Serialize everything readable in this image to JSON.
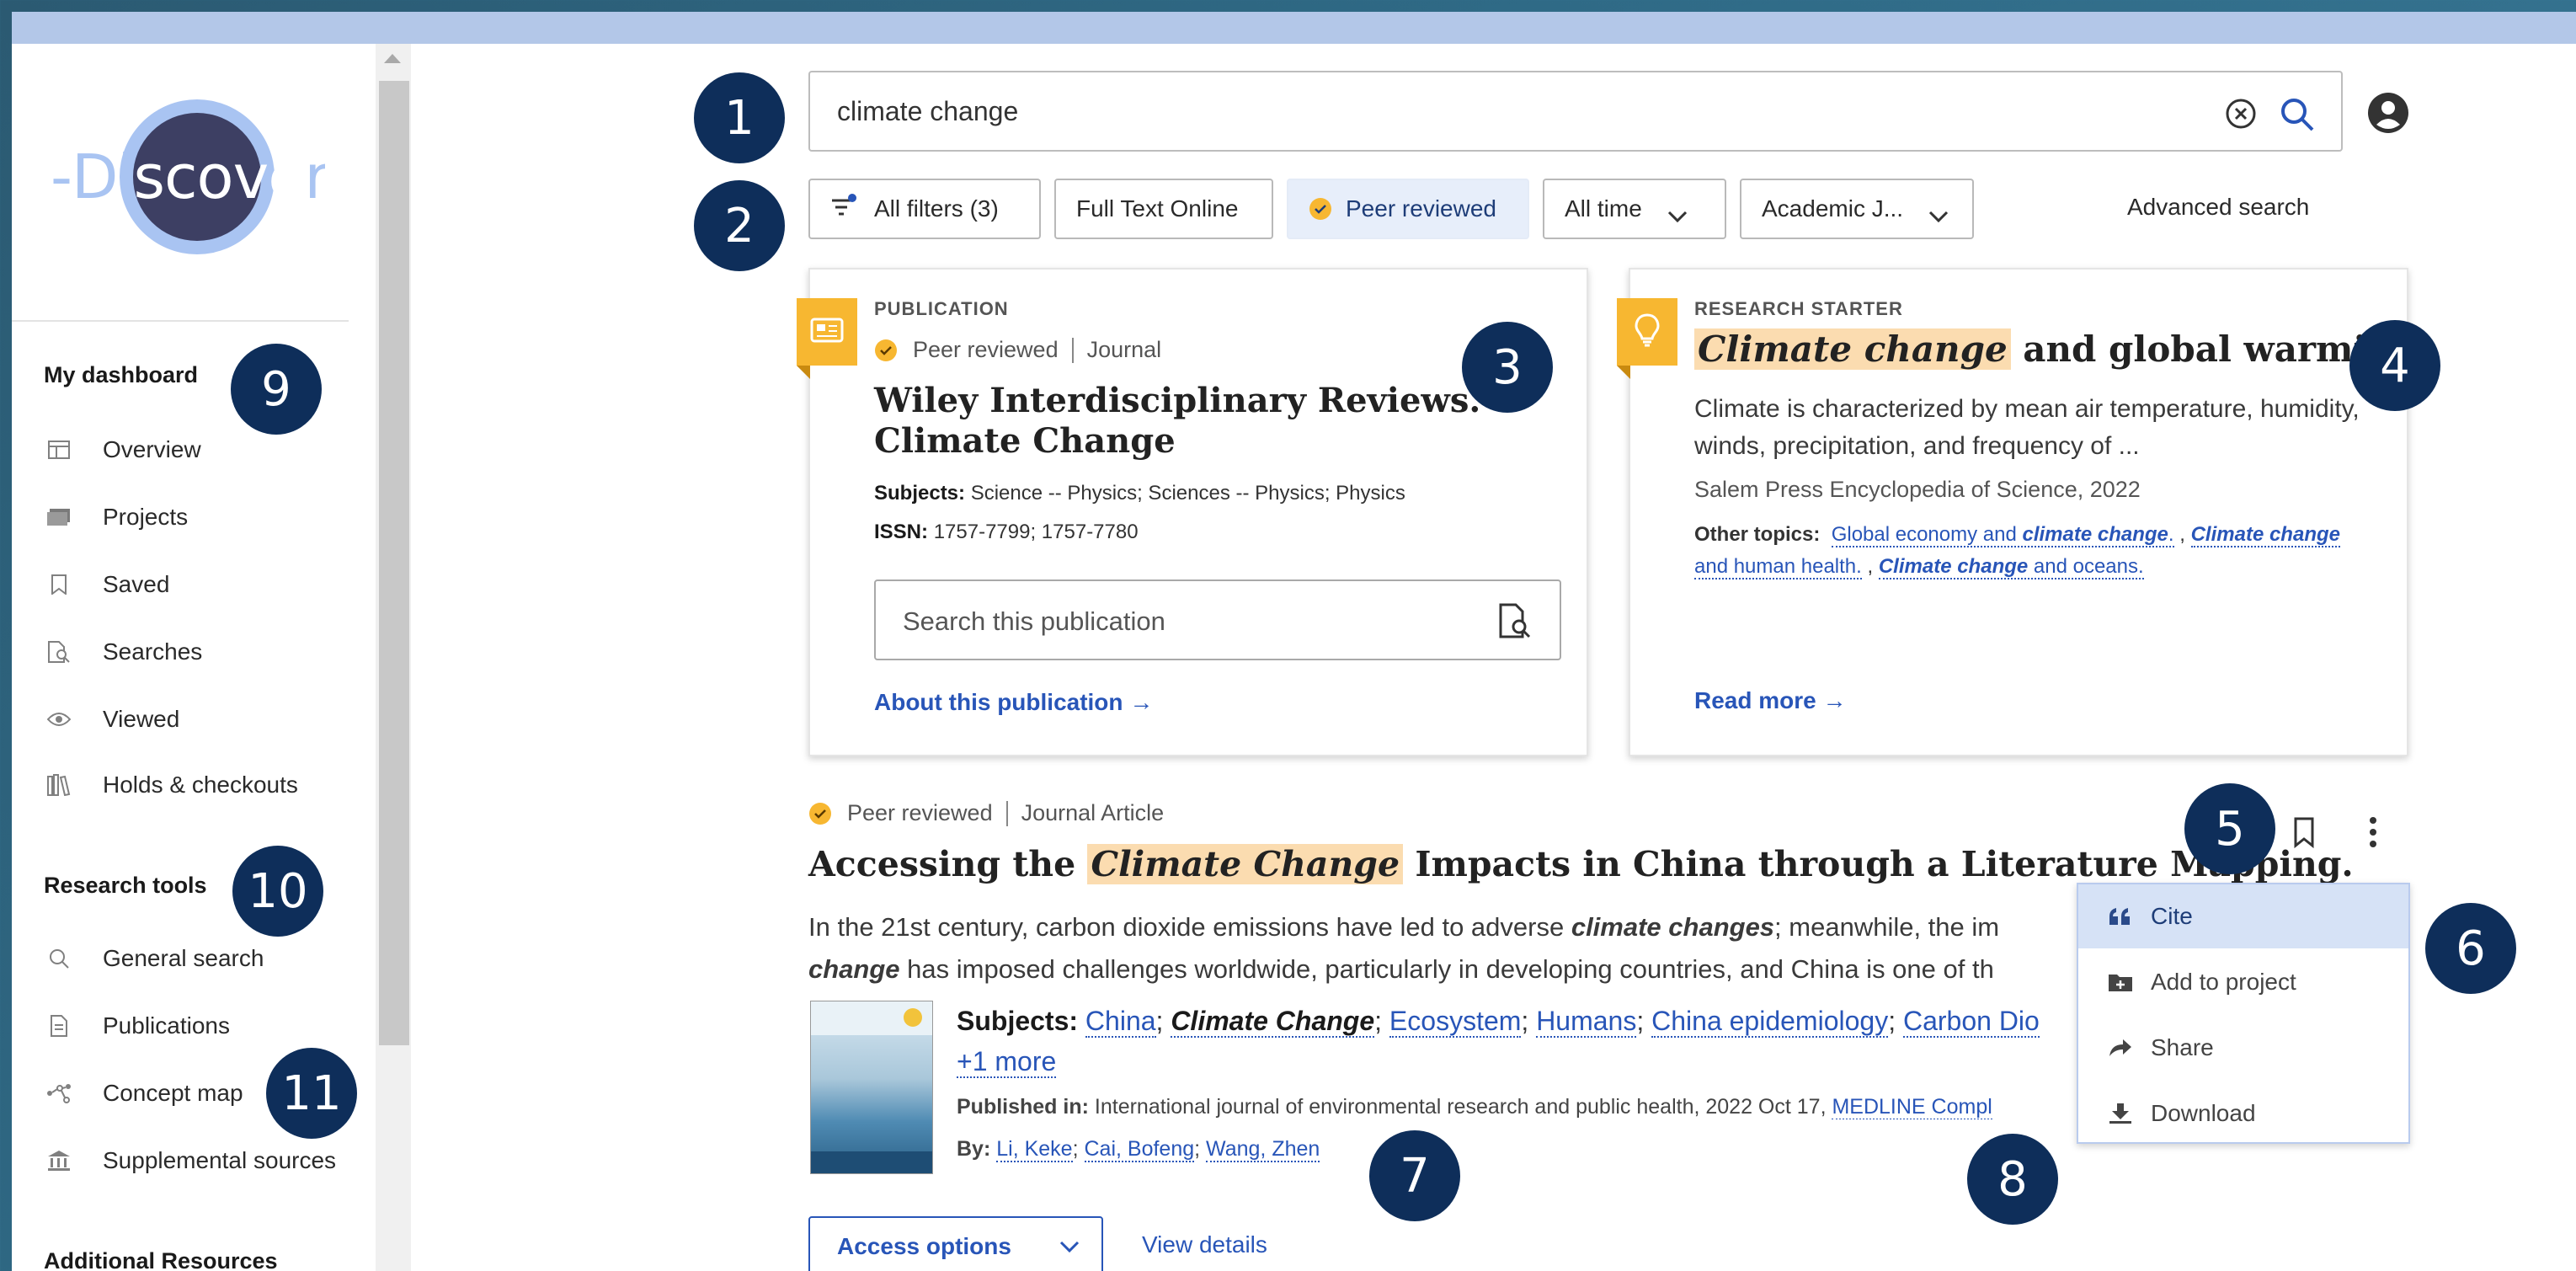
{
  "logo": {
    "text_left": "-Di",
    "text_mid": "scove",
    "text_right": "r"
  },
  "sidebar": {
    "dashboard_heading": "My dashboard",
    "dashboard_items": [
      {
        "label": "Overview",
        "icon": "layout-icon"
      },
      {
        "label": "Projects",
        "icon": "folders-icon"
      },
      {
        "label": "Saved",
        "icon": "bookmark-icon"
      },
      {
        "label": "Searches",
        "icon": "saved-search-icon"
      },
      {
        "label": "Viewed",
        "icon": "eye-icon"
      },
      {
        "label": "Holds & checkouts",
        "icon": "books-icon"
      }
    ],
    "tools_heading": "Research tools",
    "tools_items": [
      {
        "label": "General search",
        "icon": "search-icon"
      },
      {
        "label": "Publications",
        "icon": "document-icon"
      },
      {
        "label": "Concept map",
        "icon": "concept-map-icon"
      },
      {
        "label": "Supplemental sources",
        "icon": "institution-icon"
      }
    ],
    "additional_heading": "Additional Resources"
  },
  "callouts": [
    "1",
    "2",
    "3",
    "4",
    "5",
    "6",
    "7",
    "8",
    "9",
    "10",
    "11"
  ],
  "search": {
    "value": "climate change"
  },
  "filters": {
    "all_filters": "All filters (3)",
    "full_text": "Full Text Online",
    "peer_reviewed": "Peer reviewed",
    "time": "All time",
    "source_type": "Academic J...",
    "advanced": "Advanced search"
  },
  "publication_card": {
    "eyebrow": "PUBLICATION",
    "peer": "Peer reviewed",
    "type": "Journal",
    "title_line1": "Wiley Interdisciplinary Reviews.",
    "title_line2": "Climate Change",
    "subjects_label": "Subjects:",
    "subjects_value": "Science -- Physics; Sciences -- Physics; Physics",
    "issn_label": "ISSN:",
    "issn_value": "1757-7799; 1757-7780",
    "search_placeholder": "Search this publication",
    "about_link": "About this publication"
  },
  "research_card": {
    "eyebrow": "RESEARCH STARTER",
    "title_hl": "Climate change",
    "title_rest": " and global warming.",
    "desc": "Climate is characterized by mean air temperature, humidity, winds, precipitation, and frequency of ...",
    "source": "Salem Press Encyclopedia of Science, 2022",
    "topics_label": "Other topics:",
    "topic1_pre": "Global economy and ",
    "topic1_em": "climate change",
    "topic1_post": ".",
    "topic_sep": " , ",
    "topic2_em": "Climate change",
    "topic2_post": " and human health.",
    "topic3_em": "Climate change",
    "topic3_post": " and oceans.",
    "read_more": "Read more"
  },
  "result": {
    "peer": "Peer reviewed",
    "type": "Journal Article",
    "title_pre": "Accessing the ",
    "title_hl": "Climate Change",
    "title_post": " Impacts in China through a Literature Mapping.",
    "abstract_1": "In the 21st century, carbon dioxide emissions have led to adverse ",
    "abstract_em1": "climate changes",
    "abstract_2": "; meanwhile, the im",
    "abstract_em2": "change",
    "abstract_3": " has imposed challenges worldwide, particularly in developing countries, and China is one of th",
    "subjects_label": "Subjects:",
    "subjects": [
      "China",
      "Climate Change",
      "Ecosystem",
      "Humans",
      "China epidemiology",
      "Carbon Dio"
    ],
    "more": "+1 more",
    "published_label": "Published in:",
    "published_value": "International journal of environmental research and public health, 2022 Oct 17, ",
    "database": "MEDLINE Compl",
    "by_label": "By:",
    "authors": [
      "Li, Keke",
      "Cai, Bofeng",
      "Wang, Zhen"
    ],
    "access_label": "Access options",
    "view_details": "View details"
  },
  "menu": [
    {
      "label": "Cite",
      "icon": "quote-icon",
      "active": true
    },
    {
      "label": "Add to project",
      "icon": "folder-add-icon",
      "active": false
    },
    {
      "label": "Share",
      "icon": "share-icon",
      "active": false
    },
    {
      "label": "Download",
      "icon": "download-icon",
      "active": false
    }
  ],
  "colors": {
    "accent_blue": "#2855b8",
    "callout_navy": "#0e2e5a",
    "highlight": "#fbdcb0",
    "ribbon_gold": "#f7b731",
    "topbar": "#b3c7e8"
  }
}
